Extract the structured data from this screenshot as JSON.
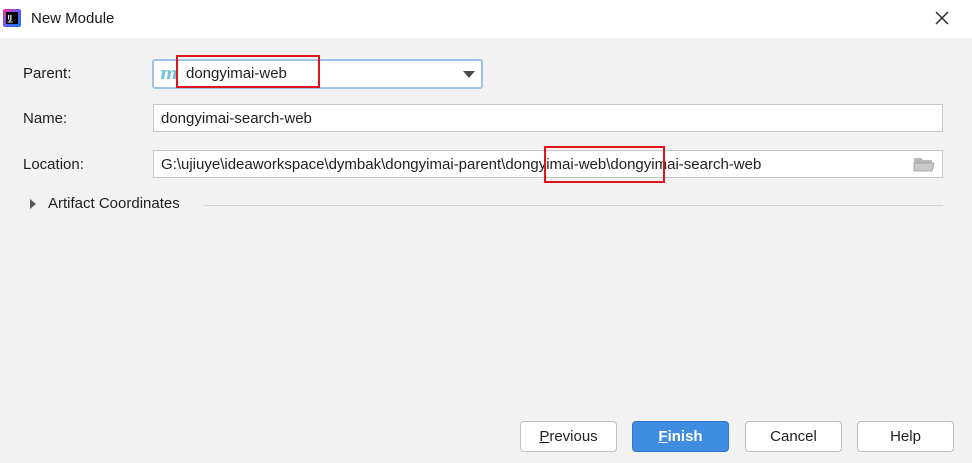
{
  "window": {
    "title": "New Module",
    "app_icon": "intellij-icon",
    "close_icon": "close-icon"
  },
  "form": {
    "parent": {
      "label": "Parent:",
      "value": "dongyimai-web",
      "icon": "maven-module-icon"
    },
    "name": {
      "label": "Name:",
      "value": "dongyimai-search-web"
    },
    "location": {
      "label": "Location:",
      "prefix": "G:\\ujiuye\\ideaworkspace\\dymbak\\dongyimai-parent\\",
      "highlight": "dongyimai-web",
      "suffix": "\\dongyimai-search-web",
      "browse_icon": "folder-icon"
    },
    "artifact_section": {
      "label": "Artifact Coordinates",
      "expanded": false
    }
  },
  "buttons": {
    "previous": {
      "mnemonic": "P",
      "rest": "revious"
    },
    "finish": {
      "mnemonic": "F",
      "rest": "inish"
    },
    "cancel": "Cancel",
    "help": "Help"
  },
  "colors": {
    "accent": "#3f8de2",
    "highlight_box": "#e0141e"
  }
}
